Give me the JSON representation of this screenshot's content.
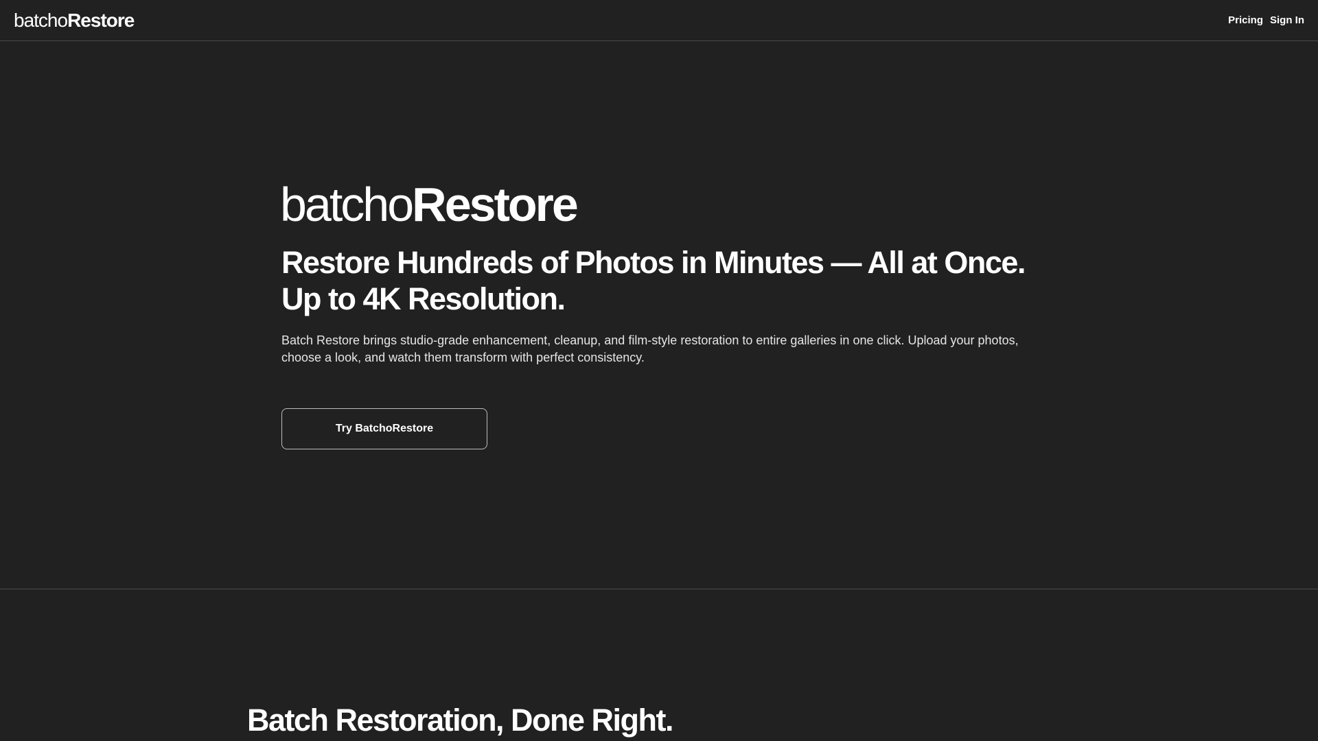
{
  "header": {
    "logo_light": "batcho",
    "logo_bold": "Restore",
    "nav": [
      {
        "label": "Pricing"
      },
      {
        "label": "Sign In"
      }
    ]
  },
  "hero": {
    "logo_light": "batcho",
    "logo_bold": "Restore",
    "title_line1": "Restore Hundreds of Photos in Minutes — All at Once.",
    "title_line2": "Up to 4K Resolution.",
    "description": "Batch Restore brings studio-grade enhancement, cleanup, and film-style restoration to entire galleries in one click. Upload your photos, choose a look, and watch them transform with perfect consistency.",
    "cta_label": "Try BatchoRestore"
  },
  "section2": {
    "title": "Batch Restoration, Done Right."
  },
  "colors": {
    "background": "#212121",
    "divider": "#4a4a4a",
    "text": "#ffffff",
    "button_border": "#bdbdbd"
  }
}
